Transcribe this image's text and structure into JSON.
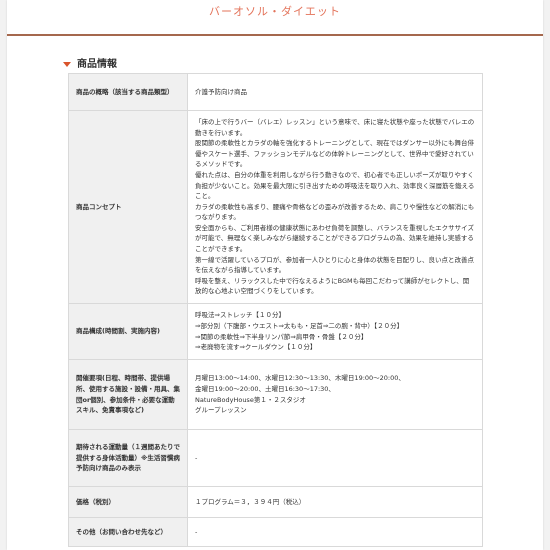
{
  "header": {
    "title": "バーオソル・ダイエット"
  },
  "section": {
    "title": "商品情報"
  },
  "rows": [
    {
      "label": "商品の概略（該当する商品類型）",
      "lines": [
        "介護予防向け商品"
      ]
    },
    {
      "label": "商品コンセプト",
      "lines": [
        "「床の上で行うバー（バレエ）レッスン」という意味で、床に寝た状態や座った状態でバレエの動きを行います。",
        "股関節の柔軟性とカラダの軸を強化するトレーニングとして、現在ではダンサー以外にも舞台俳優やスケート選手、ファッションモデルなどの体幹トレーニングとして、世界中で愛好されているメソッドです。",
        "優れた点は、自分の体重を利用しながら行う動きなので、初心者でも正しいポーズが取りやすく負担が少ないこと。効果を最大限に引き出すための呼吸法を取り入れ、効率良く深層筋を鍛えること。",
        "カラダの柔軟性も高まり、腰痛や骨格などの歪みが改善するため、肩こりや慢性などの解消にもつながります。",
        "安全面からも、ご利用者様の健康状態にあわせ負荷を調整し、バランスを重視したエクササイズが可能で、無理なく楽しみながら継続することができるプログラムの為、効果を維持し実感することができます。",
        "第一線で活躍しているプロが、参加者一人ひとりに心と身体の状態を目配りし、良い点と改善点を伝えながら指導しています。",
        "呼吸を整え、リラックスした中で行なえるようにBGMも毎回こだわって講師がセレクトし、開放的な心地よい空間づくりをしています。"
      ]
    },
    {
      "label": "商品構成(時間割、実施内容)",
      "lines": [
        "呼吸法⇒ストレッチ【１０分】",
        "⇒部分別（下腹部・ウエスト⇒太もも・足首⇒二の腕・背中）【２０分】",
        "⇒関節の柔軟性⇒下半身リンパ節⇒肩甲骨・骨盤【２０分】",
        "⇒老廃物を流す⇒クールダウン【１０分】"
      ]
    },
    {
      "label": "開催要項(日程、時間帯、提供場所、使用する施設・設備・用具、集団or個別、参加条件・必要な運動スキル、免責事項など)",
      "lines": [
        "月曜日13:00～14:00、水曜日12:30～13:30、木曜日19:00～20:00、",
        "金曜日19:00～20:00、土曜日16:30～17:30、",
        "NatureBodyHouse第１・２スタジオ",
        "グループレッスン"
      ]
    },
    {
      "label": "期待される運動量（１週間あたりで提供する身体活動量）※生活習慣病予防向け商品のみ表示",
      "lines": [
        "-"
      ]
    },
    {
      "label": "価格（税別）",
      "lines": [
        "１プログラム＝３，３９４円（税込）"
      ]
    },
    {
      "label": "その他（お問い合わせ先など）",
      "lines": [
        "-"
      ]
    }
  ]
}
